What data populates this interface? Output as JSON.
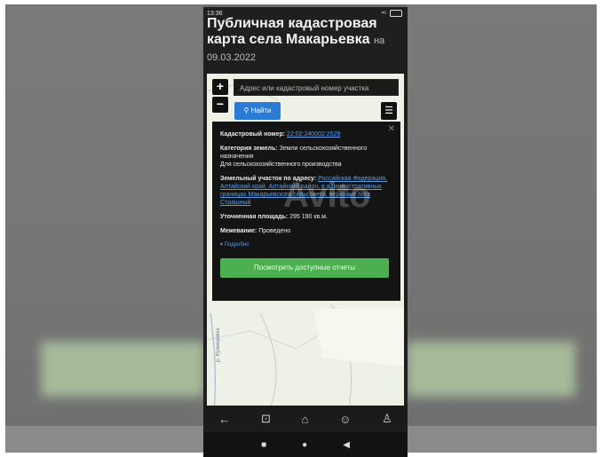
{
  "status_bar": {
    "time": "13:36",
    "signal_text": "⁴⁶"
  },
  "page": {
    "title": "Публичная кадастровая карта села Макарьевка",
    "date": "на 09.03.2022"
  },
  "map": {
    "zoom_in": "+",
    "zoom_out": "−",
    "search_placeholder": "Адрес или кадастровый номер участка",
    "find_button": "Найти",
    "find_icon": "search-icon",
    "menu_icon": "hamburger-icon",
    "river_label": "р. Кузнецовка",
    "watermark": "Avito"
  },
  "popup": {
    "cadastral_label": "Кадастровый номер:",
    "cadastral_value": "22:02:240002:2529",
    "category_label": "Категория земель:",
    "category_value": "Земли сельскохозяйственного назначения",
    "usage_value": "Для сельскохозяйственного производства",
    "address_label": "Земельный участок по адресу:",
    "address_value": "Российская Федерация, Алтайский край, Алтайский район, в административных границах Макарьевского сельсовета, верховье лога Страшный",
    "area_label": "Уточненная площадь:",
    "area_value": "295 190 кв.м.",
    "survey_label": "Межевание:",
    "survey_value": "Проведено",
    "more_link": "▾ Подробно",
    "reports_button": "Посмотреть доступные отчеты"
  },
  "nav": {
    "back": "←",
    "book": "⊡",
    "home": "⌂",
    "games": "☺",
    "profile": "♙"
  },
  "system_nav": {
    "recents": "■",
    "home": "●",
    "back": "◀"
  },
  "colors": {
    "accent_blue": "#2b7bd6",
    "accent_green": "#4caf50"
  }
}
